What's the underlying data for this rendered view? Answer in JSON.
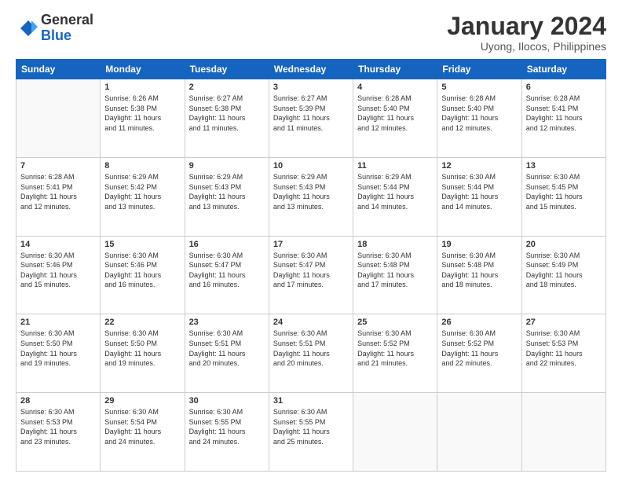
{
  "logo": {
    "general": "General",
    "blue": "Blue"
  },
  "header": {
    "month": "January 2024",
    "location": "Uyong, Ilocos, Philippines"
  },
  "weekdays": [
    "Sunday",
    "Monday",
    "Tuesday",
    "Wednesday",
    "Thursday",
    "Friday",
    "Saturday"
  ],
  "weeks": [
    [
      {
        "day": "",
        "info": ""
      },
      {
        "day": "1",
        "info": "Sunrise: 6:26 AM\nSunset: 5:38 PM\nDaylight: 11 hours\nand 11 minutes."
      },
      {
        "day": "2",
        "info": "Sunrise: 6:27 AM\nSunset: 5:38 PM\nDaylight: 11 hours\nand 11 minutes."
      },
      {
        "day": "3",
        "info": "Sunrise: 6:27 AM\nSunset: 5:39 PM\nDaylight: 11 hours\nand 11 minutes."
      },
      {
        "day": "4",
        "info": "Sunrise: 6:28 AM\nSunset: 5:40 PM\nDaylight: 11 hours\nand 12 minutes."
      },
      {
        "day": "5",
        "info": "Sunrise: 6:28 AM\nSunset: 5:40 PM\nDaylight: 11 hours\nand 12 minutes."
      },
      {
        "day": "6",
        "info": "Sunrise: 6:28 AM\nSunset: 5:41 PM\nDaylight: 11 hours\nand 12 minutes."
      }
    ],
    [
      {
        "day": "7",
        "info": "Sunrise: 6:28 AM\nSunset: 5:41 PM\nDaylight: 11 hours\nand 12 minutes."
      },
      {
        "day": "8",
        "info": "Sunrise: 6:29 AM\nSunset: 5:42 PM\nDaylight: 11 hours\nand 13 minutes."
      },
      {
        "day": "9",
        "info": "Sunrise: 6:29 AM\nSunset: 5:43 PM\nDaylight: 11 hours\nand 13 minutes."
      },
      {
        "day": "10",
        "info": "Sunrise: 6:29 AM\nSunset: 5:43 PM\nDaylight: 11 hours\nand 13 minutes."
      },
      {
        "day": "11",
        "info": "Sunrise: 6:29 AM\nSunset: 5:44 PM\nDaylight: 11 hours\nand 14 minutes."
      },
      {
        "day": "12",
        "info": "Sunrise: 6:30 AM\nSunset: 5:44 PM\nDaylight: 11 hours\nand 14 minutes."
      },
      {
        "day": "13",
        "info": "Sunrise: 6:30 AM\nSunset: 5:45 PM\nDaylight: 11 hours\nand 15 minutes."
      }
    ],
    [
      {
        "day": "14",
        "info": "Sunrise: 6:30 AM\nSunset: 5:46 PM\nDaylight: 11 hours\nand 15 minutes."
      },
      {
        "day": "15",
        "info": "Sunrise: 6:30 AM\nSunset: 5:46 PM\nDaylight: 11 hours\nand 16 minutes."
      },
      {
        "day": "16",
        "info": "Sunrise: 6:30 AM\nSunset: 5:47 PM\nDaylight: 11 hours\nand 16 minutes."
      },
      {
        "day": "17",
        "info": "Sunrise: 6:30 AM\nSunset: 5:47 PM\nDaylight: 11 hours\nand 17 minutes."
      },
      {
        "day": "18",
        "info": "Sunrise: 6:30 AM\nSunset: 5:48 PM\nDaylight: 11 hours\nand 17 minutes."
      },
      {
        "day": "19",
        "info": "Sunrise: 6:30 AM\nSunset: 5:48 PM\nDaylight: 11 hours\nand 18 minutes."
      },
      {
        "day": "20",
        "info": "Sunrise: 6:30 AM\nSunset: 5:49 PM\nDaylight: 11 hours\nand 18 minutes."
      }
    ],
    [
      {
        "day": "21",
        "info": "Sunrise: 6:30 AM\nSunset: 5:50 PM\nDaylight: 11 hours\nand 19 minutes."
      },
      {
        "day": "22",
        "info": "Sunrise: 6:30 AM\nSunset: 5:50 PM\nDaylight: 11 hours\nand 19 minutes."
      },
      {
        "day": "23",
        "info": "Sunrise: 6:30 AM\nSunset: 5:51 PM\nDaylight: 11 hours\nand 20 minutes."
      },
      {
        "day": "24",
        "info": "Sunrise: 6:30 AM\nSunset: 5:51 PM\nDaylight: 11 hours\nand 20 minutes."
      },
      {
        "day": "25",
        "info": "Sunrise: 6:30 AM\nSunset: 5:52 PM\nDaylight: 11 hours\nand 21 minutes."
      },
      {
        "day": "26",
        "info": "Sunrise: 6:30 AM\nSunset: 5:52 PM\nDaylight: 11 hours\nand 22 minutes."
      },
      {
        "day": "27",
        "info": "Sunrise: 6:30 AM\nSunset: 5:53 PM\nDaylight: 11 hours\nand 22 minutes."
      }
    ],
    [
      {
        "day": "28",
        "info": "Sunrise: 6:30 AM\nSunset: 5:53 PM\nDaylight: 11 hours\nand 23 minutes."
      },
      {
        "day": "29",
        "info": "Sunrise: 6:30 AM\nSunset: 5:54 PM\nDaylight: 11 hours\nand 24 minutes."
      },
      {
        "day": "30",
        "info": "Sunrise: 6:30 AM\nSunset: 5:55 PM\nDaylight: 11 hours\nand 24 minutes."
      },
      {
        "day": "31",
        "info": "Sunrise: 6:30 AM\nSunset: 5:55 PM\nDaylight: 11 hours\nand 25 minutes."
      },
      {
        "day": "",
        "info": ""
      },
      {
        "day": "",
        "info": ""
      },
      {
        "day": "",
        "info": ""
      }
    ]
  ]
}
